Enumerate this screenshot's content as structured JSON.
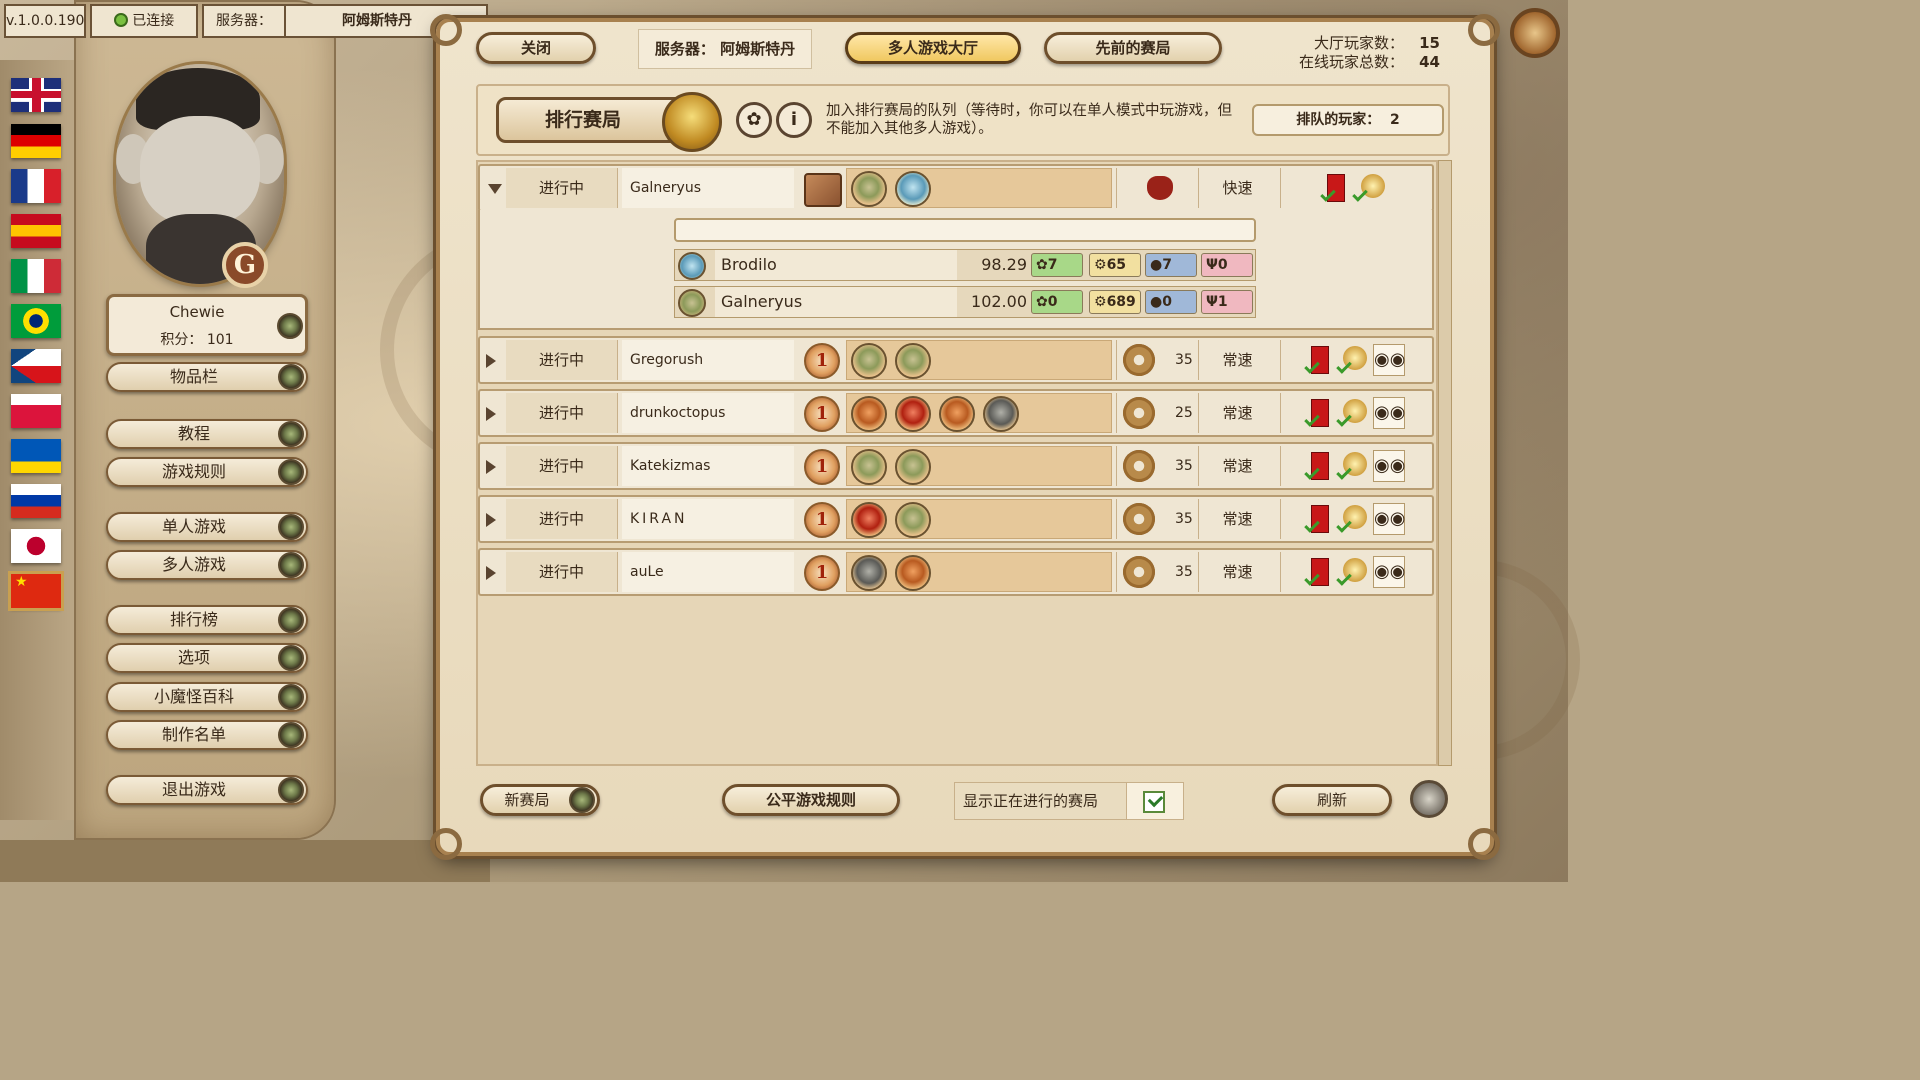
{
  "flags": [
    {
      "name": "uk-flag",
      "colors": [
        "#1d2f7a",
        "#ffffff",
        "#c8102e"
      ]
    },
    {
      "name": "germany-flag",
      "colors": [
        "#000000",
        "#dd0000",
        "#ffce00"
      ]
    },
    {
      "name": "france-flag",
      "colors": [
        "#1a3a8a",
        "#ffffff",
        "#d8202a"
      ]
    },
    {
      "name": "spain-flag",
      "colors": [
        "#c60b1e",
        "#ffc400",
        "#c60b1e"
      ]
    },
    {
      "name": "italy-flag",
      "colors": [
        "#009246",
        "#ffffff",
        "#ce2b37"
      ]
    },
    {
      "name": "brazil-flag",
      "colors": [
        "#009c3b",
        "#ffdf00",
        "#002776"
      ]
    },
    {
      "name": "czech-flag",
      "colors": [
        "#ffffff",
        "#d7141a",
        "#11457e"
      ]
    },
    {
      "name": "poland-flag",
      "colors": [
        "#ffffff",
        "#dc143c",
        "#dc143c"
      ]
    },
    {
      "name": "ukraine-flag",
      "colors": [
        "#0057b7",
        "#0057b7",
        "#ffd700"
      ]
    },
    {
      "name": "russia-flag",
      "colors": [
        "#ffffff",
        "#0039a6",
        "#d52b1e"
      ]
    },
    {
      "name": "japan-flag",
      "colors": [
        "#ffffff",
        "#bc002d",
        "#ffffff"
      ]
    },
    {
      "name": "china-flag",
      "colors": [
        "#de2910",
        "#ffde00",
        "#de2910"
      ],
      "selected": true
    }
  ],
  "profile": {
    "name": "Chewie",
    "score_label": "积分：",
    "score": "101",
    "badge": "G"
  },
  "menu": {
    "inventory": "物品栏",
    "tutorial": "教程",
    "rules": "游戏规则",
    "single": "单人游戏",
    "multi": "多人游戏",
    "leaderboard": "排行榜",
    "options": "选项",
    "wiki": "小魔怪百科",
    "credits": "制作名单",
    "quit": "退出游戏"
  },
  "status": {
    "version": "v.1.0.0.190",
    "connection": "已连接",
    "server_label": "服务器：",
    "server_value": "阿姆斯特丹"
  },
  "top": {
    "close": "关闭",
    "server_label": "服务器：",
    "server_value": "阿姆斯特丹",
    "lobby": "多人游戏大厅",
    "previous": "先前的赛局",
    "lobby_players_label": "大厅玩家数：",
    "lobby_players": "15",
    "online_players_label": "在线玩家总数：",
    "online_players": "44"
  },
  "ranked": {
    "button": "排行赛局",
    "info_icon": "i",
    "description": "加入排行赛局的队列（等待时，你可以在单人模式中玩游戏，但不能加入其他多人游戏）。",
    "queue_label": "排队的玩家：",
    "queue_count": "2"
  },
  "games": [
    {
      "state": "进行中",
      "host": "Galneryus",
      "type": "cards",
      "cost": "",
      "speed": "快速",
      "masked": false
    },
    {
      "state": "进行中",
      "host": "Gregorush",
      "type": "ranked",
      "cost": "35",
      "speed": "常速",
      "masked": true
    },
    {
      "state": "进行中",
      "host": "drunkoctopus",
      "type": "ranked",
      "cost": "25",
      "speed": "常速",
      "masked": true
    },
    {
      "state": "进行中",
      "host": "Katekizmas",
      "type": "ranked",
      "cost": "35",
      "speed": "常速",
      "masked": true
    },
    {
      "state": "进行中",
      "host": "KIRAN",
      "type": "ranked",
      "cost": "35",
      "speed": "常速",
      "masked": true
    },
    {
      "state": "进行中",
      "host": "auLe",
      "type": "ranked",
      "cost": "35",
      "speed": "常速",
      "masked": true
    }
  ],
  "expanded_players": [
    {
      "name": "Brodilo",
      "score": "98.29",
      "gears": "7",
      "coins": "65",
      "bombs": "7",
      "forks": "0",
      "avatar": "blue"
    },
    {
      "name": "Galneryus",
      "score": "102.00",
      "gears": "0",
      "coins": "689",
      "bombs": "0",
      "forks": "1",
      "avatar": "green"
    }
  ],
  "stat_icons": {
    "gears": "✿",
    "coins": "⚙",
    "bombs": "●",
    "forks": "Ψ"
  },
  "bottom": {
    "new_game": "新赛局",
    "fair_rules": "公平游戏规则",
    "show_running": "显示正在进行的赛局",
    "refresh": "刷新"
  }
}
